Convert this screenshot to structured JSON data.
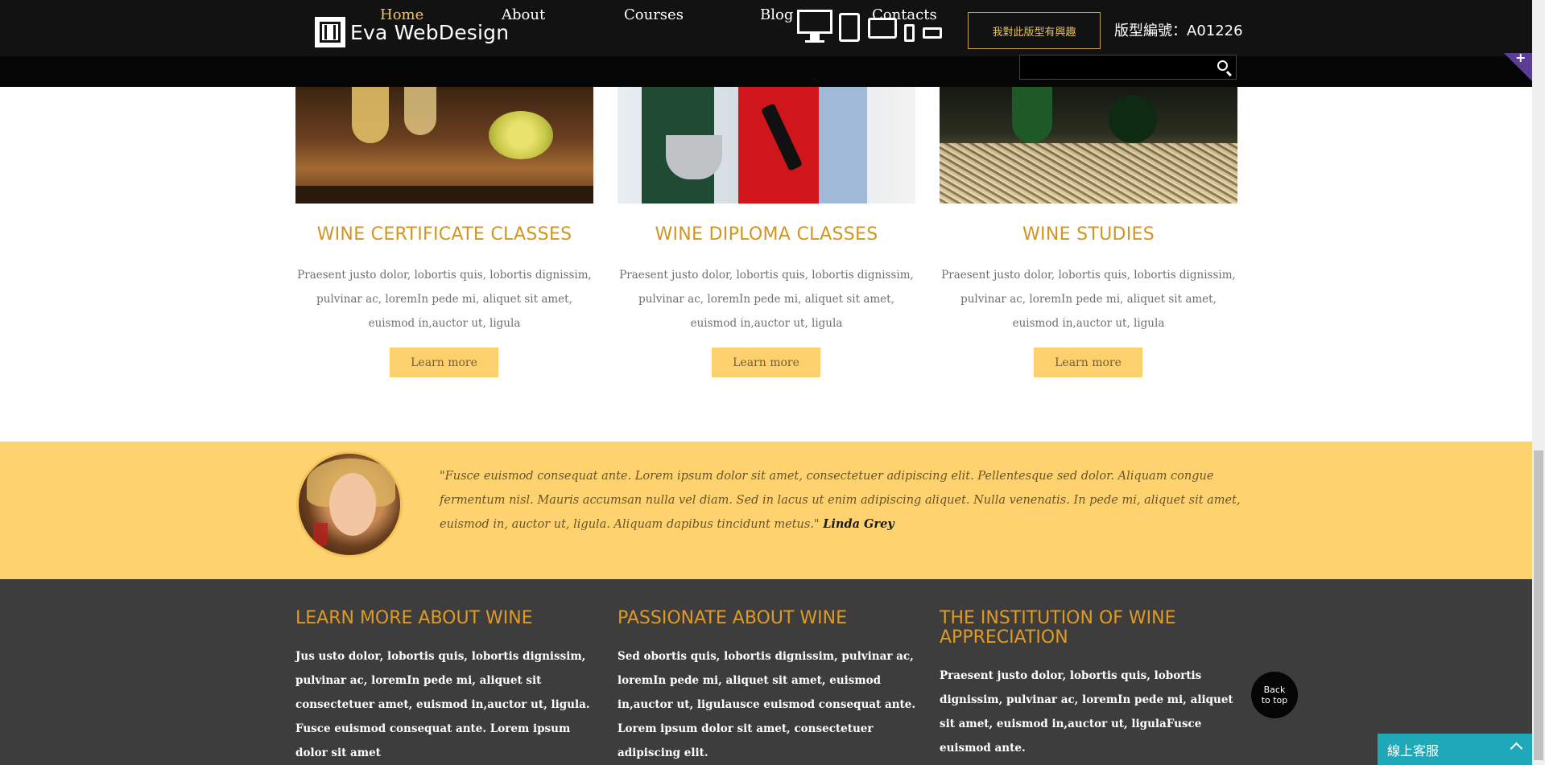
{
  "header": {
    "logo_text": "Eva WebDesign",
    "interest_button": "我對此版型有興趣",
    "template_number": "版型編號：A01226",
    "devices": [
      "desktop-icon",
      "tablet-portrait-icon",
      "tablet-landscape-icon",
      "phone-portrait-icon",
      "phone-landscape-icon"
    ]
  },
  "nav": {
    "items": [
      {
        "label": "Home",
        "active": true
      },
      {
        "label": "About"
      },
      {
        "label": "Courses"
      },
      {
        "label": "Blog"
      },
      {
        "label": "Contacts"
      }
    ],
    "search_placeholder": ""
  },
  "cards": [
    {
      "title": "WINE CERTIFICATE CLASSES",
      "text": "Praesent justo dolor, lobortis quis, lobortis dignissim, pulvinar ac, loremIn pede mi, aliquet sit amet, euismod in,auctor ut, ligula",
      "button": "Learn more"
    },
    {
      "title": "WINE DIPLOMA CLASSES",
      "text": "Praesent justo dolor, lobortis quis, lobortis dignissim, pulvinar ac, loremIn pede mi, aliquet sit amet, euismod in,auctor ut, ligula",
      "button": "Learn more"
    },
    {
      "title": "WINE STUDIES",
      "text": "Praesent justo dolor, lobortis quis, lobortis dignissim, pulvinar ac, loremIn pede mi, aliquet sit amet, euismod in,auctor ut, ligula",
      "button": "Learn more"
    }
  ],
  "testimonial": {
    "quote": "\"Fusce euismod consequat ante. Lorem ipsum dolor sit amet, consectetuer adipiscing elit. Pellentesque sed dolor. Aliquam congue fermentum nisl. Mauris accumsan nulla vel diam. Sed in lacus ut enim adipiscing aliquet. Nulla venenatis. In pede mi, aliquet sit amet, euismod in, auctor ut, ligula. Aliquam dapibus tincidunt metus.\"",
    "author": "Linda Grey"
  },
  "footer": {
    "columns": [
      {
        "title": "LEARN MORE ABOUT WINE",
        "text": "Jus usto dolor, lobortis quis, lobortis dignissim, pulvinar ac, loremIn pede mi, aliquet sit consectetuer amet, euismod in,auctor ut, ligula. Fusce euismod consequat ante. Lorem ipsum dolor sit amet"
      },
      {
        "title": "PASSIONATE ABOUT WINE",
        "text": "Sed obortis quis, lobortis dignissim, pulvinar ac, loremIn pede mi, aliquet sit amet, euismod in,auctor ut, ligulausce euismod consequat ante. Lorem ipsum dolor sit amet, consectetuer adipiscing elit."
      },
      {
        "title": "THE INSTITUTION OF WINE APPRECIATION",
        "text": "Praesent justo dolor, lobortis quis, lobortis dignissim, pulvinar ac, loremIn pede mi, aliquet sit amet, euismod in,auctor ut, ligulaFusce euismod ante."
      }
    ]
  },
  "back_to_top": "Back to top",
  "chat": {
    "label": "線上客服"
  },
  "colors": {
    "accent": "#d49520",
    "nav_active": "#f6c25a",
    "button_bg": "#fdd06e",
    "testimonial_bg": "#fdd26f",
    "footer_bg": "#3d3d3d",
    "chat_bg": "#1fa8b7"
  }
}
